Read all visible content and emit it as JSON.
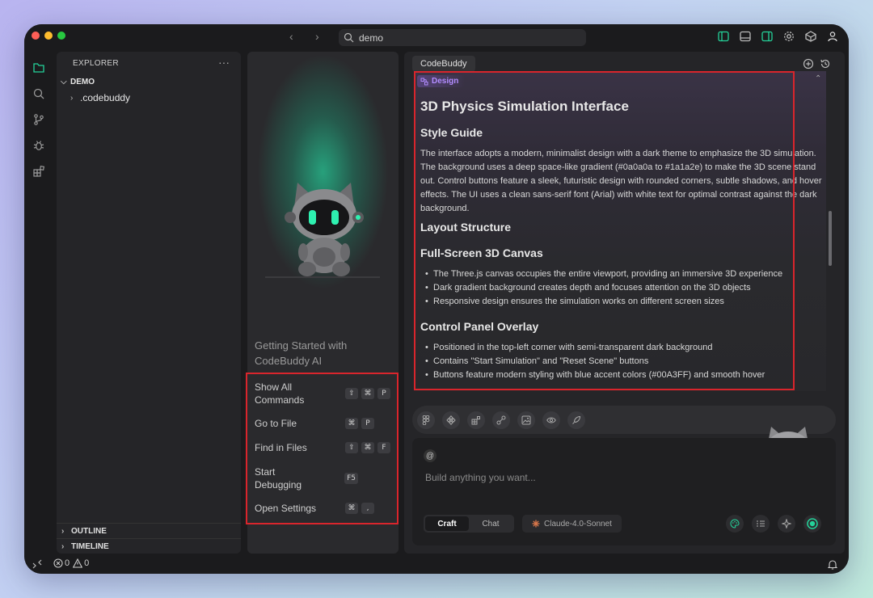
{
  "search": {
    "value": "demo"
  },
  "explorer": {
    "title": "EXPLORER",
    "more": "···",
    "root_folder": "DEMO",
    "items": [
      {
        "label": ".codebuddy"
      }
    ],
    "outline_label": "OUTLINE",
    "timeline_label": "TIMELINE"
  },
  "welcome": {
    "title": "Getting Started with CodeBuddy AI",
    "commands": [
      {
        "label": "Show All Commands",
        "keys": [
          "⇧",
          "⌘",
          "P"
        ]
      },
      {
        "label": "Go to File",
        "keys": [
          "⌘",
          "P"
        ]
      },
      {
        "label": "Find in Files",
        "keys": [
          "⇧",
          "⌘",
          "F"
        ]
      },
      {
        "label": "Start Debugging",
        "keys": [
          "F5"
        ]
      },
      {
        "label": "Open Settings",
        "keys": [
          "⌘",
          ","
        ]
      }
    ]
  },
  "codebuddy": {
    "tab_label": "CodeBuddy",
    "badge": "Design",
    "doc": {
      "h1": "3D Physics Simulation Interface",
      "style_guide_heading": "Style Guide",
      "style_guide_text": "The interface adopts a modern, minimalist design with a dark theme to emphasize the 3D simulation. The background uses a deep space-like gradient (#0a0a0a to #1a1a2e) to make the 3D scene stand out. Control buttons feature a sleek, futuristic design with rounded corners, subtle shadows, and hover effects. The UI uses a clean sans-serif font (Arial) with white text for optimal contrast against the dark background.",
      "layout_heading": "Layout Structure",
      "canvas_heading": "Full-Screen 3D Canvas",
      "canvas_items": [
        "The Three.js canvas occupies the entire viewport, providing an immersive 3D experience",
        "Dark gradient background creates depth and focuses attention on the 3D objects",
        "Responsive design ensures the simulation works on different screen sizes"
      ],
      "control_heading": "Control Panel Overlay",
      "control_items": [
        "Positioned in the top-left corner with semi-transparent dark background",
        "Contains \"Start Simulation\" and \"Reset Scene\" buttons",
        "Buttons feature modern styling with blue accent colors (#00A3FF) and smooth hover"
      ]
    },
    "at_symbol": "@",
    "input_placeholder": "Build anything you want...",
    "modes": [
      "Craft",
      "Chat"
    ],
    "model": "Claude-4.0-Sonnet"
  },
  "status": {
    "errors": "0",
    "warnings": "0"
  },
  "colors": {
    "accent_green": "#24d39a",
    "highlight_red": "#d9252c",
    "design_purple": "#b28cff"
  }
}
